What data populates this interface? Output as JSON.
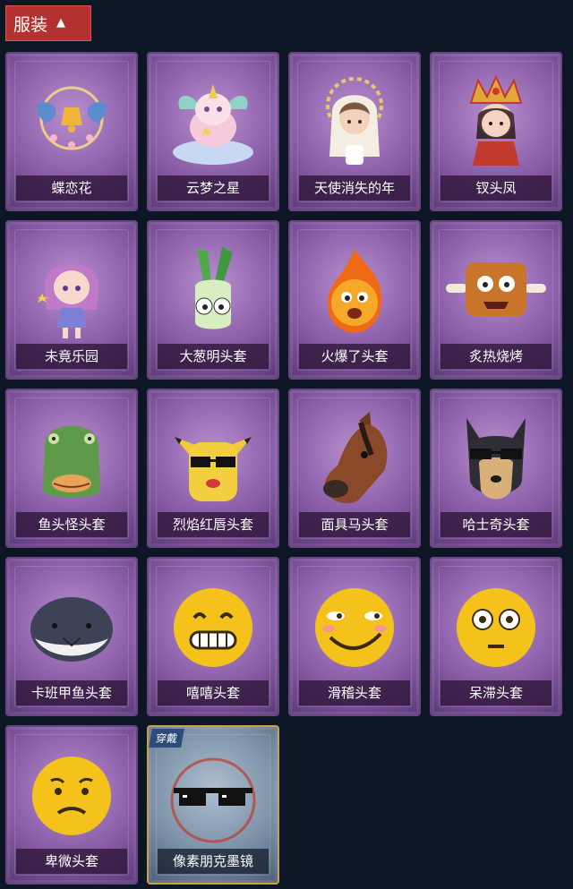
{
  "header": {
    "title": "服装",
    "expand_icon": "chevron-up-icon"
  },
  "items": [
    {
      "name": "蝶恋花",
      "icon": "butterfly-bell-ornament-icon"
    },
    {
      "name": "云梦之星",
      "icon": "unicorn-cloud-icon"
    },
    {
      "name": "天使消失的年",
      "icon": "angel-halo-doll-icon"
    },
    {
      "name": "钗头凤",
      "icon": "phoenix-crown-doll-icon"
    },
    {
      "name": "未竟乐园",
      "icon": "fairy-girl-doll-icon"
    },
    {
      "name": "大葱明头套",
      "icon": "scallion-head-icon"
    },
    {
      "name": "火爆了头套",
      "icon": "fireball-head-icon"
    },
    {
      "name": "炙热烧烤",
      "icon": "bbq-meat-head-icon"
    },
    {
      "name": "鱼头怪头套",
      "icon": "fish-monster-mask-icon"
    },
    {
      "name": "烈焰红唇头套",
      "icon": "yellow-pikachu-sunglasses-icon"
    },
    {
      "name": "面具马头套",
      "icon": "horse-mask-icon"
    },
    {
      "name": "哈士奇头套",
      "icon": "husky-sunglasses-icon"
    },
    {
      "name": "卡班甲鱼头套",
      "icon": "round-fish-head-icon"
    },
    {
      "name": "嘻嘻头套",
      "icon": "grin-emoji-icon"
    },
    {
      "name": "滑稽头套",
      "icon": "funny-emoji-icon"
    },
    {
      "name": "呆滞头套",
      "icon": "dazed-emoji-icon"
    },
    {
      "name": "卑微头套",
      "icon": "humble-emoji-icon"
    },
    {
      "name": "像素朋克墨镜",
      "icon": "pixel-sunglasses-icon",
      "badge": "穿戴",
      "equipped": true
    }
  ]
}
